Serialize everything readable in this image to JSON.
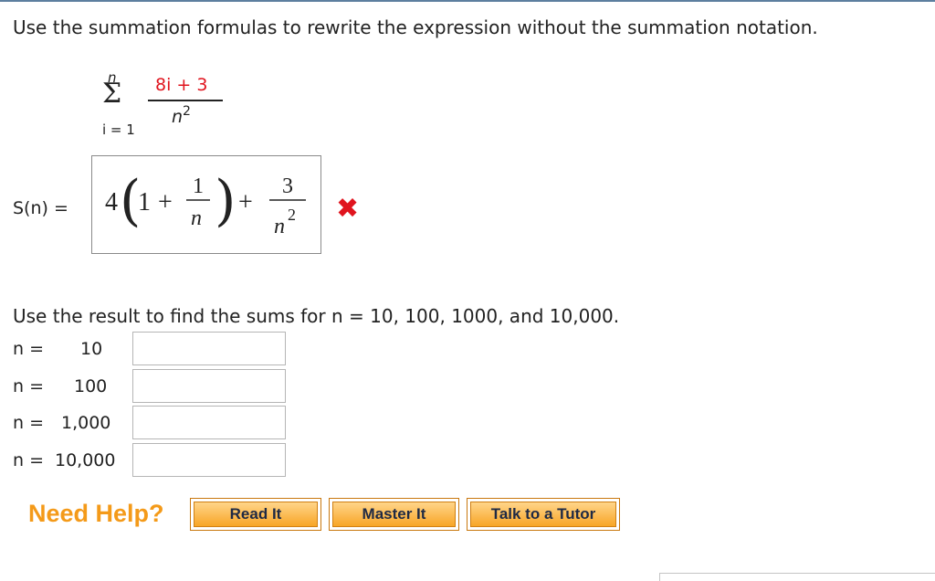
{
  "question": {
    "instruction": "Use the summation formulas to rewrite the expression without the summation notation.",
    "summation": {
      "upper_limit": "n",
      "sigma_symbol": "Σ",
      "lower_limit": "i = 1",
      "numerator": "8i + 3",
      "denominator_base": "n",
      "denominator_exponent": "2"
    },
    "answer": {
      "label": "S(n) =",
      "entered_expression": {
        "coefficient": "4",
        "inner_one": "1",
        "plus_sign": "+",
        "inner_frac_num": "1",
        "inner_frac_den": "n",
        "outer_plus": "+",
        "outer_frac_num": "3",
        "outer_frac_den_base": "n",
        "outer_frac_den_exp": "2"
      },
      "status": "incorrect",
      "status_mark": "✖",
      "status_color": "#e0141e"
    },
    "followup": "Use the result to find the sums for n = 10, 100, 1000, and 10,000.",
    "n_rows": [
      {
        "label": "n =",
        "value": "10",
        "input_value": ""
      },
      {
        "label": "n =",
        "value": "100",
        "input_value": ""
      },
      {
        "label": "n =",
        "value": "1,000",
        "input_value": ""
      },
      {
        "label": "n =",
        "value": "10,000",
        "input_value": ""
      }
    ]
  },
  "help": {
    "title": "Need Help?",
    "title_color": "#f49a19",
    "buttons": [
      "Read It",
      "Master It",
      "Talk to a Tutor"
    ]
  }
}
